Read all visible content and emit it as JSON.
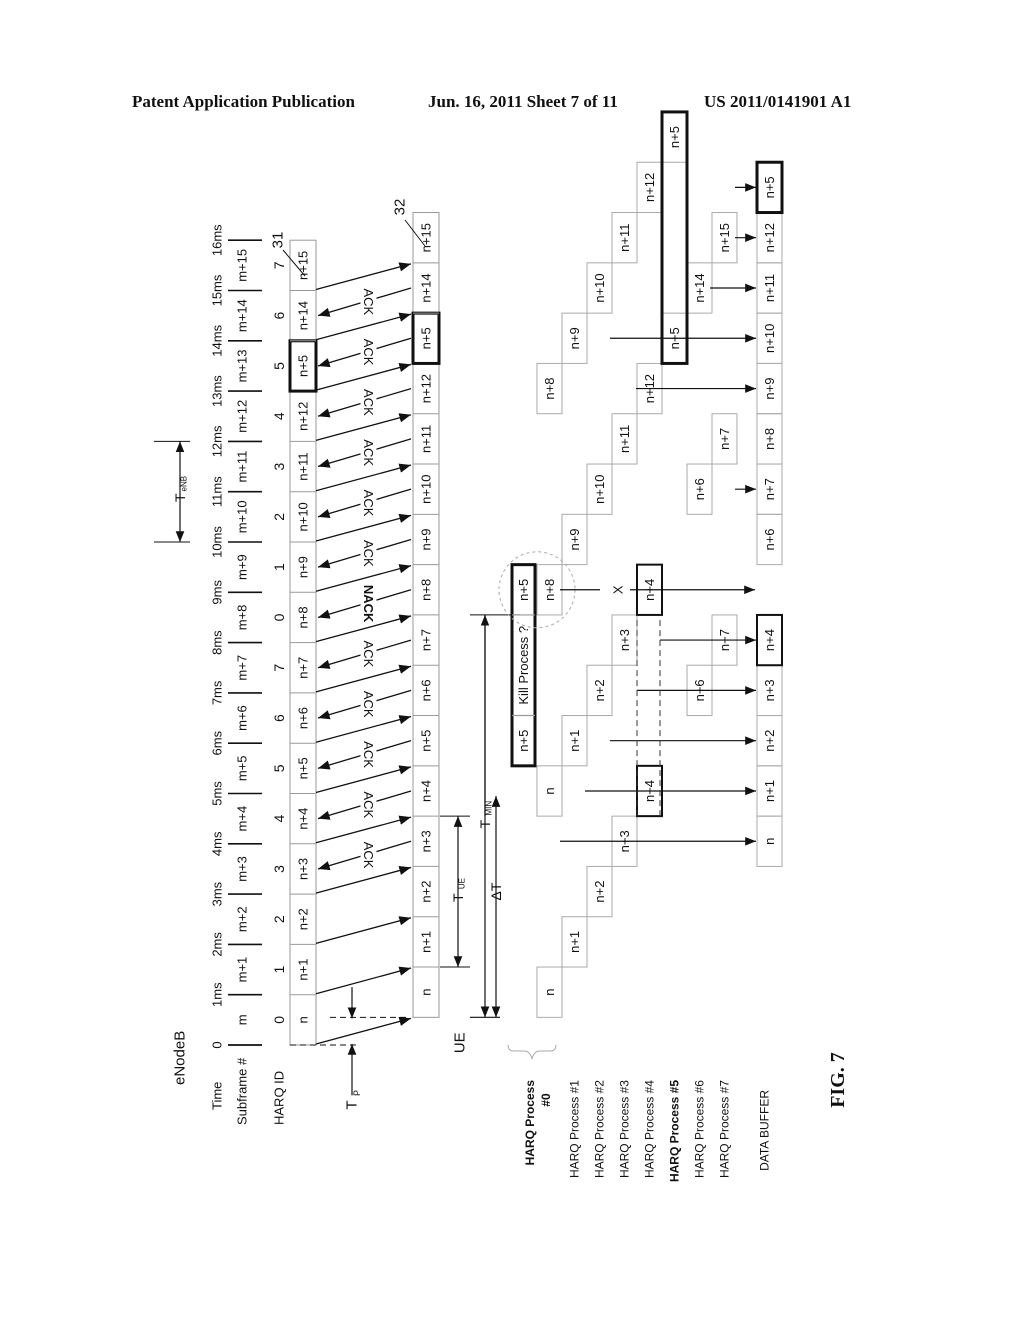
{
  "header": {
    "left": "Patent Application Publication",
    "date_sheet": "Jun. 16, 2011   Sheet 7 of 11",
    "pub_number": "US 2011/0141901 A1"
  },
  "figure": {
    "label": "FIG. 7",
    "enb_label": "eNodeB",
    "ue_label": "UE",
    "row_labels": {
      "time": "Time",
      "subframe": "Subframe #",
      "harq_id": "HARQ ID"
    },
    "time_ticks": [
      "0",
      "1ms",
      "2ms",
      "3ms",
      "4ms",
      "5ms",
      "6ms",
      "7ms",
      "8ms",
      "9ms",
      "10ms",
      "11ms",
      "12ms",
      "13ms",
      "14ms",
      "15ms",
      "16ms"
    ],
    "subframes": [
      "m",
      "m+1",
      "m+2",
      "m+3",
      "m+4",
      "m+5",
      "m+6",
      "m+7",
      "m+8",
      "m+9",
      "m+10",
      "m+11",
      "m+12",
      "m+13",
      "m+14",
      "m+15"
    ],
    "harq_ids": [
      "0",
      "1",
      "2",
      "3",
      "4",
      "5",
      "6",
      "7",
      "0",
      "1",
      "2",
      "3",
      "4",
      "5",
      "6",
      "7"
    ],
    "enb_packets": [
      "n",
      "n+1",
      "n+2",
      "n+3",
      "n+4",
      "n+5",
      "n+6",
      "n+7",
      "n+8",
      "n+9",
      "n+10",
      "n+11",
      "n+12",
      "n+5",
      "n+14",
      "n+15"
    ],
    "ue_packets": [
      "n",
      "n+1",
      "n+2",
      "n+3",
      "n+4",
      "n+5",
      "n+6",
      "n+7",
      "n+8",
      "n+9",
      "n+10",
      "n+11",
      "n+12",
      "n+5",
      "n+14",
      "n+15"
    ],
    "feedback": [
      "",
      "",
      "",
      "",
      "ACK",
      "ACK",
      "ACK",
      "ACK",
      "ACK",
      "NACK",
      "ACK",
      "ACK",
      "ACK",
      "ACK",
      "ACK",
      "ACK"
    ],
    "ref_31": "31",
    "ref_32": "32",
    "timing": {
      "tp": "T",
      "tp_sub": "P",
      "tue": "T",
      "tue_sub": "UE",
      "tmin": "T",
      "tmin_sub": "MIN",
      "delta_t": "ΔT",
      "tenb": "T",
      "tenb_sub": "eNB"
    },
    "harq_processes": [
      {
        "label": "HARQ Process",
        "label2": "#0",
        "bold": true
      },
      {
        "label": "HARQ Process #1",
        "bold": false
      },
      {
        "label": "HARQ Process #2",
        "bold": false
      },
      {
        "label": "HARQ Process #3",
        "bold": false
      },
      {
        "label": "HARQ Process #4",
        "bold": false
      },
      {
        "label": "HARQ Process #5",
        "bold": true
      },
      {
        "label": "HARQ Process #6",
        "bold": false
      },
      {
        "label": "HARQ Process #7",
        "bold": false
      }
    ],
    "kill_box": {
      "left": "n+5",
      "middle": "Kill Process ?",
      "right": "n+5"
    },
    "lost_marker": "X",
    "data_buffer_label": "DATA BUFFER",
    "data_buffer": [
      "n",
      "n+1",
      "n+2",
      "n+3",
      "n+4",
      "n+6",
      "n+7",
      "n+8",
      "n+9",
      "n+10",
      "n+11",
      "n+12",
      "n+5"
    ]
  }
}
